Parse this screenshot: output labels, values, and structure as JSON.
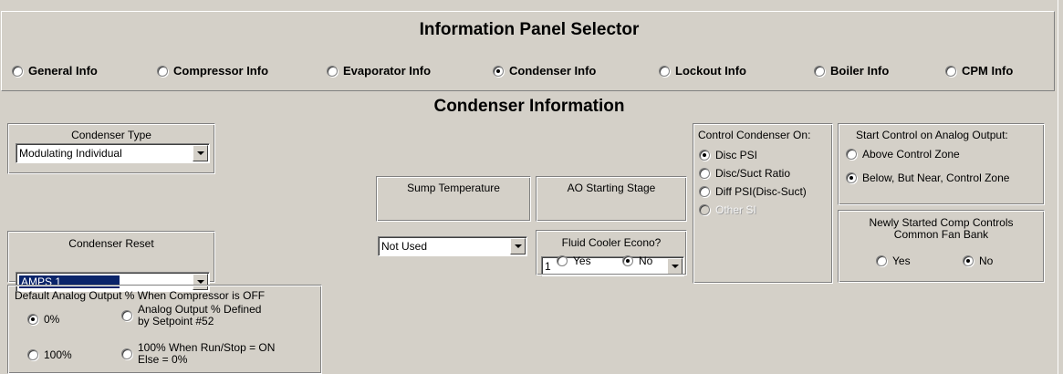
{
  "selector": {
    "title": "Information Panel Selector",
    "options": [
      {
        "label": "General Info",
        "checked": false
      },
      {
        "label": "Compressor Info",
        "checked": false
      },
      {
        "label": "Evaporator Info",
        "checked": false
      },
      {
        "label": "Condenser Info",
        "checked": true
      },
      {
        "label": "Lockout Info",
        "checked": false
      },
      {
        "label": "Boiler Info",
        "checked": false
      },
      {
        "label": "CPM Info",
        "checked": false
      }
    ]
  },
  "condenser": {
    "title": "Condenser Information",
    "type": {
      "label": "Condenser Type",
      "value": "Modulating Individual"
    },
    "reset": {
      "label": "Condenser Reset",
      "value": "AMPS 1"
    },
    "sump": {
      "label": "Sump Temperature",
      "value": "Not Used"
    },
    "ao_stage": {
      "label": "AO Starting Stage",
      "value": "1"
    },
    "fluid_cooler": {
      "label": "Fluid Cooler Econo?",
      "yes": "Yes",
      "no": "No",
      "selected": "No"
    },
    "control_on": {
      "label": "Control Condenser On:",
      "options": [
        {
          "label": "Disc PSI",
          "checked": true,
          "disabled": false
        },
        {
          "label": "Disc/Suct Ratio",
          "checked": false,
          "disabled": false
        },
        {
          "label": "Diff PSI(Disc-Suct)",
          "checked": false,
          "disabled": false
        },
        {
          "label": "Other SI",
          "checked": false,
          "disabled": true
        }
      ]
    },
    "start_control": {
      "label": "Start Control on Analog Output:",
      "options": [
        {
          "label": "Above Control Zone",
          "checked": false
        },
        {
          "label": "Below, But Near, Control Zone",
          "checked": true
        }
      ]
    },
    "newly_started": {
      "label_line1": "Newly Started Comp Controls",
      "label_line2": "Common Fan Bank",
      "yes": "Yes",
      "no": "No",
      "selected": "No"
    },
    "default_ao": {
      "label": "Default Analog Output % When Compressor is OFF",
      "opt_0": "0%",
      "opt_100": "100%",
      "opt_setpoint_line1": "Analog Output % Defined",
      "opt_setpoint_line2": "by Setpoint #52",
      "opt_runstop_line1": "100% When Run/Stop = ON",
      "opt_runstop_line2": "Else = 0%",
      "selected": "0%"
    }
  },
  "icons": {
    "combo_arrow": "chevron-down-icon",
    "radio": "radio-button"
  }
}
